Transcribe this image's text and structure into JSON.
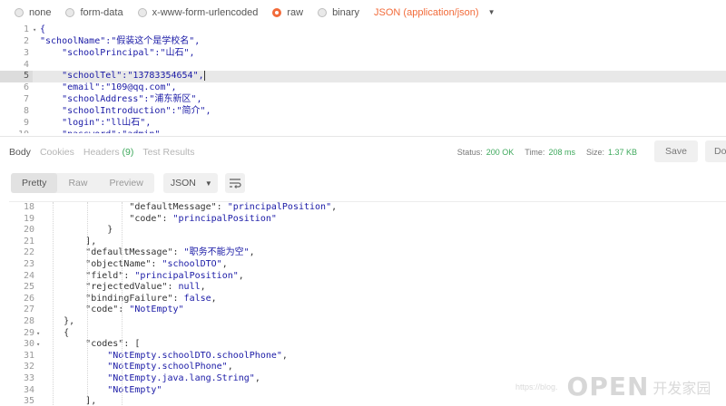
{
  "body_types": {
    "options": [
      "none",
      "form-data",
      "x-www-form-urlencoded",
      "raw",
      "binary"
    ],
    "selected": "raw",
    "content_type": "JSON (application/json)"
  },
  "request_body": {
    "lines": [
      {
        "n": "1",
        "text": "{"
      },
      {
        "n": "2",
        "text": "\"schoolName\":\"假装这个是学校名\","
      },
      {
        "n": "3",
        "text": "    \"schoolPrincipal\":\"山石\","
      },
      {
        "n": "4",
        "text": ""
      },
      {
        "n": "5",
        "text": "    \"schoolTel\":\"13783354654\","
      },
      {
        "n": "6",
        "text": "    \"email\":\"109@qq.com\","
      },
      {
        "n": "7",
        "text": "    \"schoolAddress\":\"浦东新区\","
      },
      {
        "n": "8",
        "text": "    \"schoolIntroduction\":\"简介\","
      },
      {
        "n": "9",
        "text": "    \"login\":\"ll山石\","
      },
      {
        "n": "10",
        "text": "    \"password\":\"admin\""
      }
    ]
  },
  "response_tabs": {
    "body": "Body",
    "cookies": "Cookies",
    "headers": "Headers",
    "headers_count": "(9)",
    "test_results": "Test Results"
  },
  "response_stats": {
    "status_label": "Status:",
    "status_value": "200 OK",
    "time_label": "Time:",
    "time_value": "208 ms",
    "size_label": "Size:",
    "size_value": "1.37 KB"
  },
  "actions": {
    "save": "Save",
    "download": "Do"
  },
  "format": {
    "pretty": "Pretty",
    "raw": "Raw",
    "preview": "Preview",
    "language": "JSON"
  },
  "response_body": {
    "lines": [
      {
        "n": "18",
        "fold": "",
        "indent": "                ",
        "key": "\"defaultMessage\"",
        "sep": ": ",
        "val": "\"principalPosition\"",
        "tail": ","
      },
      {
        "n": "19",
        "fold": "",
        "indent": "                ",
        "key": "\"code\"",
        "sep": ": ",
        "val": "\"principalPosition\"",
        "tail": ""
      },
      {
        "n": "20",
        "fold": "",
        "indent": "            ",
        "key": "",
        "sep": "",
        "val": "",
        "tail": "}"
      },
      {
        "n": "21",
        "fold": "",
        "indent": "        ",
        "key": "",
        "sep": "",
        "val": "",
        "tail": "],"
      },
      {
        "n": "22",
        "fold": "",
        "indent": "        ",
        "key": "\"defaultMessage\"",
        "sep": ": ",
        "val": "\"职务不能为空\"",
        "tail": ","
      },
      {
        "n": "23",
        "fold": "",
        "indent": "        ",
        "key": "\"objectName\"",
        "sep": ": ",
        "val": "\"schoolDTO\"",
        "tail": ","
      },
      {
        "n": "24",
        "fold": "",
        "indent": "        ",
        "key": "\"field\"",
        "sep": ": ",
        "val": "\"principalPosition\"",
        "tail": ","
      },
      {
        "n": "25",
        "fold": "",
        "indent": "        ",
        "key": "\"rejectedValue\"",
        "sep": ": ",
        "val": "null",
        "tail": ","
      },
      {
        "n": "26",
        "fold": "",
        "indent": "        ",
        "key": "\"bindingFailure\"",
        "sep": ": ",
        "val": "false",
        "tail": ","
      },
      {
        "n": "27",
        "fold": "",
        "indent": "        ",
        "key": "\"code\"",
        "sep": ": ",
        "val": "\"NotEmpty\"",
        "tail": ""
      },
      {
        "n": "28",
        "fold": "",
        "indent": "    ",
        "key": "",
        "sep": "",
        "val": "",
        "tail": "},"
      },
      {
        "n": "29",
        "fold": "▾",
        "indent": "    ",
        "key": "",
        "sep": "",
        "val": "",
        "tail": "{"
      },
      {
        "n": "30",
        "fold": "▾",
        "indent": "        ",
        "key": "\"codes\"",
        "sep": ": ",
        "val": "",
        "tail": "["
      },
      {
        "n": "31",
        "fold": "",
        "indent": "            ",
        "key": "",
        "sep": "",
        "val": "\"NotEmpty.schoolDTO.schoolPhone\"",
        "tail": ","
      },
      {
        "n": "32",
        "fold": "",
        "indent": "            ",
        "key": "",
        "sep": "",
        "val": "\"NotEmpty.schoolPhone\"",
        "tail": ","
      },
      {
        "n": "33",
        "fold": "",
        "indent": "            ",
        "key": "",
        "sep": "",
        "val": "\"NotEmpty.java.lang.String\"",
        "tail": ","
      },
      {
        "n": "34",
        "fold": "",
        "indent": "            ",
        "key": "",
        "sep": "",
        "val": "\"NotEmpty\"",
        "tail": ""
      },
      {
        "n": "35",
        "fold": "",
        "indent": "        ",
        "key": "",
        "sep": "",
        "val": "",
        "tail": "],"
      }
    ]
  },
  "watermark": {
    "url": "https://blog.",
    "brand": "OPEN",
    "cn": "开发家园"
  },
  "colors": {
    "accent": "#f26b3a",
    "success": "#3fa95d",
    "string": "#1a1aa6"
  }
}
